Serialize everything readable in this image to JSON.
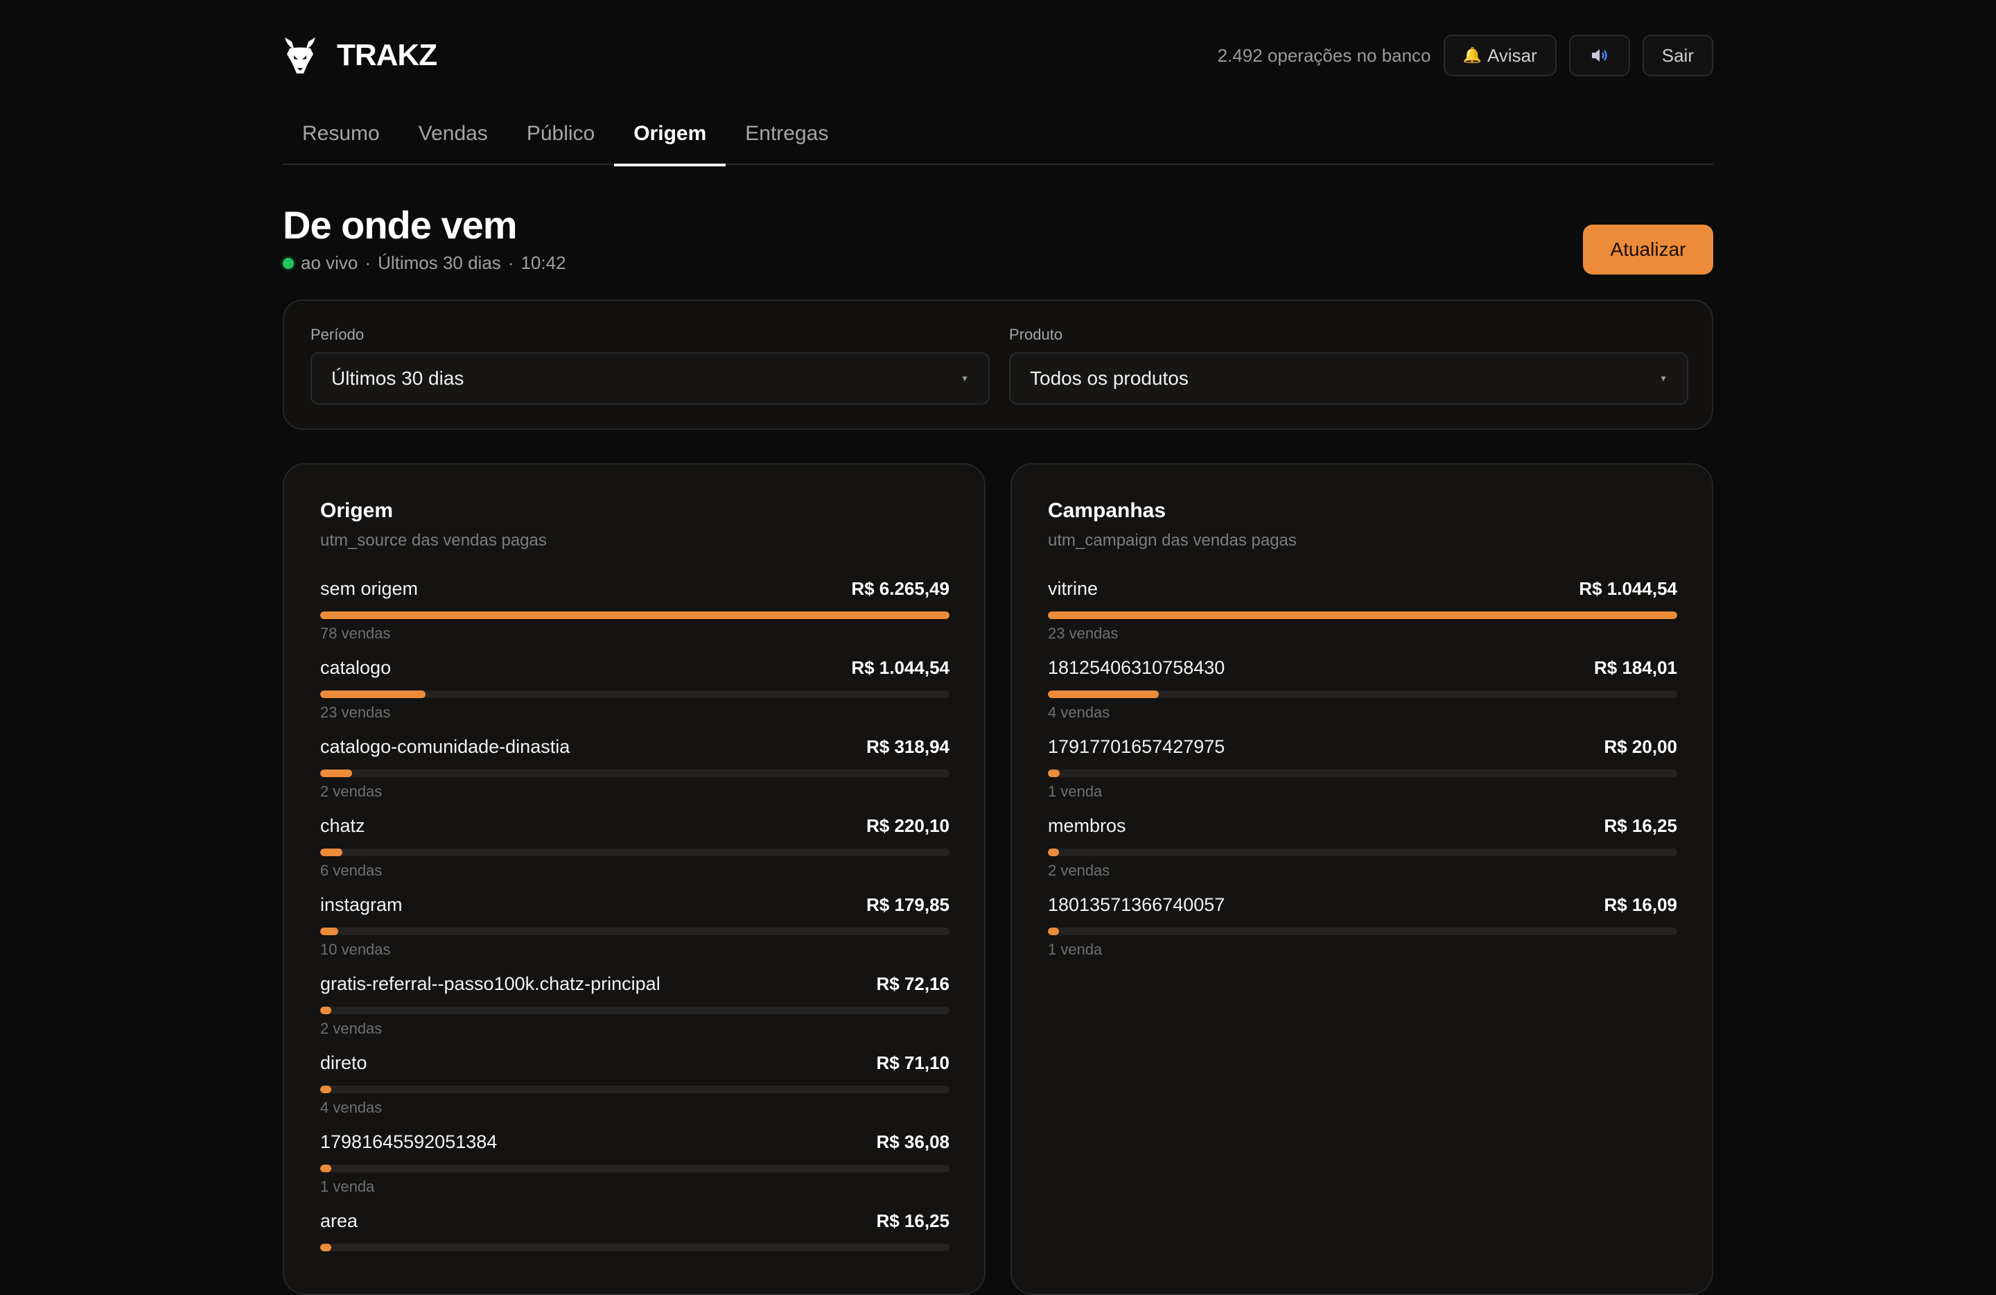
{
  "header": {
    "brand": "TRAKZ",
    "ops_text": "2.492 operações no banco",
    "notify_label": "Avisar",
    "sound_icon": "speaker-icon",
    "logout_label": "Sair"
  },
  "tabs": [
    {
      "label": "Resumo",
      "active": false
    },
    {
      "label": "Vendas",
      "active": false
    },
    {
      "label": "Público",
      "active": false
    },
    {
      "label": "Origem",
      "active": true
    },
    {
      "label": "Entregas",
      "active": false
    }
  ],
  "page": {
    "title": "De onde vem",
    "live_label": "ao vivo",
    "period_text": "Últimos 30 dias",
    "time": "10:42",
    "refresh_label": "Atualizar"
  },
  "filters": {
    "period_label": "Período",
    "period_value": "Últimos 30 dias",
    "product_label": "Produto",
    "product_value": "Todos os produtos"
  },
  "origem": {
    "title": "Origem",
    "subtitle": "utm_source das vendas pagas",
    "rows": [
      {
        "name": "sem origem",
        "value": "R$ 6.265,49",
        "count": "78 vendas",
        "share": 1.0
      },
      {
        "name": "catalogo",
        "value": "R$ 1.044,54",
        "count": "23 vendas",
        "share": 0.167
      },
      {
        "name": "catalogo-comunidade-dinastia",
        "value": "R$ 318,94",
        "count": "2 vendas",
        "share": 0.051
      },
      {
        "name": "chatz",
        "value": "R$ 220,10",
        "count": "6 vendas",
        "share": 0.035
      },
      {
        "name": "instagram",
        "value": "R$ 179,85",
        "count": "10 vendas",
        "share": 0.029
      },
      {
        "name": "gratis-referral--passo100k.chatz-principal",
        "value": "R$ 72,16",
        "count": "2 vendas",
        "share": 0.012
      },
      {
        "name": "direto",
        "value": "R$ 71,10",
        "count": "4 vendas",
        "share": 0.011
      },
      {
        "name": "17981645592051384",
        "value": "R$ 36,08",
        "count": "1 venda",
        "share": 0.006
      },
      {
        "name": "area",
        "value": "R$ 16,25",
        "count": "",
        "share": 0.003
      }
    ]
  },
  "campanhas": {
    "title": "Campanhas",
    "subtitle": "utm_campaign das vendas pagas",
    "rows": [
      {
        "name": "vitrine",
        "value": "R$ 1.044,54",
        "count": "23 vendas",
        "share": 1.0
      },
      {
        "name": "18125406310758430",
        "value": "R$ 184,01",
        "count": "4 vendas",
        "share": 0.176
      },
      {
        "name": "17917701657427975",
        "value": "R$ 20,00",
        "count": "1 venda",
        "share": 0.019
      },
      {
        "name": "membros",
        "value": "R$ 16,25",
        "count": "2 vendas",
        "share": 0.016
      },
      {
        "name": "18013571366740057",
        "value": "R$ 16,09",
        "count": "1 venda",
        "share": 0.015
      }
    ]
  },
  "colors": {
    "accent": "#ec8b3a",
    "live": "#22c55e",
    "background": "#0b0b0b"
  }
}
